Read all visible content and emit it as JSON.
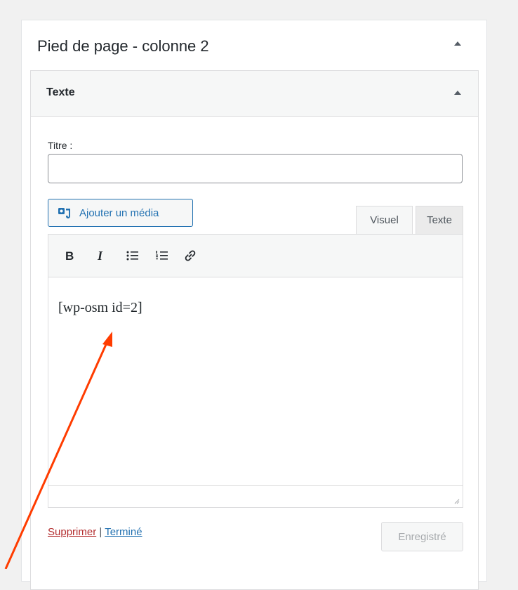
{
  "sidebar_area": {
    "title": "Pied de page - colonne 2"
  },
  "widget": {
    "title": "Texte",
    "fields": {
      "title_label": "Titre :",
      "title_value": ""
    },
    "media_button_label": "Ajouter un média",
    "tabs": [
      {
        "label": "Visuel",
        "active": true
      },
      {
        "label": "Texte",
        "active": false
      }
    ],
    "toolbar": {
      "icons": [
        "bold-icon",
        "italic-icon",
        "bullet-list-icon",
        "numbered-list-icon",
        "link-icon"
      ]
    },
    "editor_content": "[wp-osm id=2]",
    "actions": {
      "delete_label": "Supprimer",
      "separator": "|",
      "done_label": "Terminé",
      "save_label": "Enregistré"
    }
  },
  "colors": {
    "link_blue": "#2271b1",
    "delete_red": "#b32d2e",
    "annotation_arrow": "#ff3c00"
  }
}
